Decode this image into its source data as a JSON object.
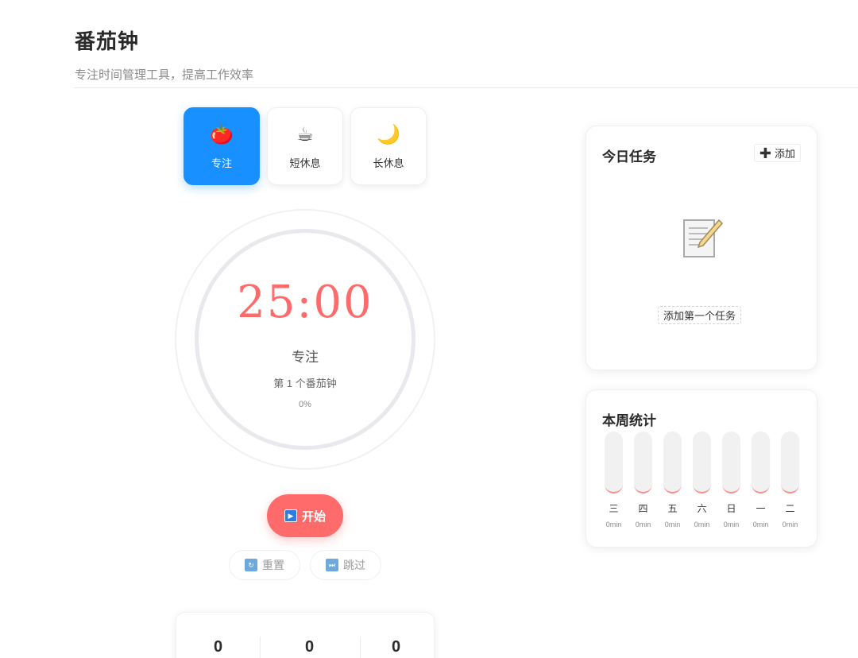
{
  "header": {
    "title": "番茄钟",
    "subtitle": "专注时间管理工具，提高工作效率"
  },
  "modes": [
    {
      "label": "专注",
      "icon": "🍅",
      "icon_name": "tomato-icon",
      "active": true
    },
    {
      "label": "短休息",
      "icon": "☕",
      "icon_name": "coffee-icon",
      "active": false
    },
    {
      "label": "长休息",
      "icon": "🌙",
      "icon_name": "moon-icon",
      "active": false
    }
  ],
  "timer": {
    "time": "25:00",
    "mode_label": "专注",
    "count_text": "第 1 个番茄钟",
    "progress_text": "0%",
    "progress": 0
  },
  "controls": {
    "start_label": "开始",
    "reset_label": "重置",
    "skip_label": "跳过"
  },
  "stats": {
    "values": [
      "0",
      "0",
      "0"
    ]
  },
  "tasks": {
    "title": "今日任务",
    "add_label": "添加",
    "empty_action_label": "添加第一个任务"
  },
  "weekly": {
    "title": "本周统计",
    "days": [
      {
        "day": "三",
        "minutes": "0min",
        "value": 0
      },
      {
        "day": "四",
        "minutes": "0min",
        "value": 0
      },
      {
        "day": "五",
        "minutes": "0min",
        "value": 0
      },
      {
        "day": "六",
        "minutes": "0min",
        "value": 0
      },
      {
        "day": "日",
        "minutes": "0min",
        "value": 0
      },
      {
        "day": "一",
        "minutes": "0min",
        "value": 0
      },
      {
        "day": "二",
        "minutes": "0min",
        "value": 0
      }
    ]
  },
  "colors": {
    "accent": "#1890ff",
    "focus": "#ff6b6b"
  }
}
